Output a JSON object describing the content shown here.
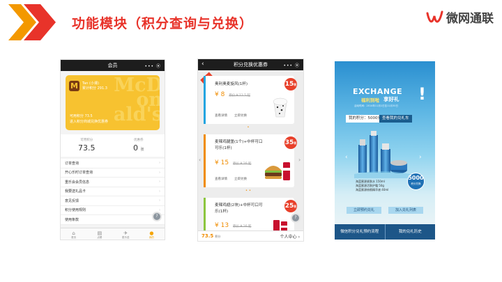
{
  "slide": {
    "title": "功能模块（积分查询与兑换）",
    "logo_text": "微网通联"
  },
  "phone1": {
    "nav_title": "会员",
    "nav_controls": "•••  ⦿",
    "card": {
      "name": "Tan (小谭)",
      "total_points": "累计积分 291.3",
      "available": "可用积分 73.5",
      "hint": "进入积分商城兑换优惠券",
      "brand_bg": "McD on ald's",
      "logo_glyph": "M"
    },
    "stats": [
      {
        "label": "可用积分",
        "value": "73.5",
        "unit": ""
      },
      {
        "label": "优惠券",
        "value": "0",
        "unit": "张"
      }
    ],
    "menu": [
      "订单查询",
      "开心乐时订单查询",
      "重乐会会员信息",
      "我要送礼品卡",
      "意见反馈",
      "积分使用规则",
      "使用条款"
    ],
    "tabs": [
      "首页",
      "点餐",
      "麦乐送",
      "我的"
    ]
  },
  "phone2": {
    "nav_title": "积分兑换优惠券",
    "nav_controls": "•••  ⦿",
    "coupons": [
      {
        "name_lines": [
          "奥利奥麦旋风(1杯)"
        ],
        "price": "¥ 8",
        "old_price": "原价 ¥ 11.5 起",
        "badge": "15",
        "links": [
          "查看详情",
          "立即兑换"
        ],
        "stripe": "#24a5e0"
      },
      {
        "name_lines": [
          "麦辣鸡腿堡(1个)+中杯可口",
          "可乐(1杯)"
        ],
        "price": "¥ 15",
        "old_price": "原价 ¥ 26 起",
        "badge": "35",
        "links": [
          "查看详情",
          "立即兑换"
        ],
        "stripe": "#f08c00"
      },
      {
        "name_lines": [
          "麦辣鸡翅(2块)+中杯可口可",
          "乐(1杯)"
        ],
        "price": "¥ 13",
        "old_price": "原价 ¥ 16 起",
        "badge": "25",
        "links": [],
        "stripe": "#8cc63f"
      }
    ],
    "ribbon": "NEW",
    "badge_unit": "积分",
    "points": "73.5",
    "points_unit": "积分",
    "user_center": "个人中心"
  },
  "phone3": {
    "headline": "EXCHANGE",
    "sub_yellow": "福利到啦",
    "sub_white": "享好礼",
    "date_range": "活动时间：2014年11月1日至11月30日",
    "my_points": "我的积分：5000分",
    "view_gifts": "查看我的兑礼车",
    "product_lines": [
      "海蓝蜜源紧肤水 150ml",
      "海蓝蜜源活肤护霜 50g",
      "海蓝蜜源修颜精华液 40ml"
    ],
    "seal_value": "5000",
    "seal_unit": "积分兑换",
    "btn_reserve": "立即预约兑礼",
    "btn_list": "加入兑礼列表",
    "footer": [
      "微信积分兑礼预约流程",
      "我的兑礼历史"
    ]
  },
  "colors": {
    "accent_red": "#e8332a",
    "chevron_orange": "#f39800",
    "mcd_yellow": "#f7c230",
    "coupon_orange": "#f08c00",
    "exchange_blue": "#1d5688"
  }
}
